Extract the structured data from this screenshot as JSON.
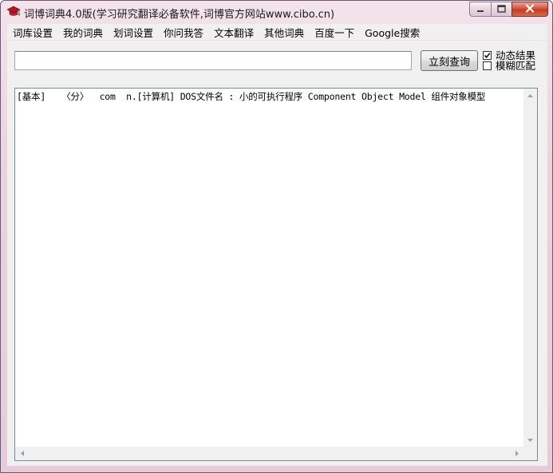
{
  "window": {
    "title": "词博词典4.0版(学习研究翻译必备软件,词博官方网站www.cibo.cn)",
    "icon": "graduation-cap-icon"
  },
  "menu": {
    "items": [
      {
        "label": "词库设置"
      },
      {
        "label": "我的词典"
      },
      {
        "label": "划词设置"
      },
      {
        "label": "你问我答"
      },
      {
        "label": "文本翻译"
      },
      {
        "label": "其他词典"
      },
      {
        "label": "百度一下"
      },
      {
        "label": "Google搜索"
      }
    ]
  },
  "search": {
    "value": "",
    "query_button": "立刻查询"
  },
  "options": {
    "dynamic_results": {
      "label": "动态结果",
      "checked": true
    },
    "fuzzy_match": {
      "label": "模糊匹配",
      "checked": false
    }
  },
  "results": {
    "line1": "[基本]   〈分〉  com  n.[计算机] DOS文件名 : 小的可执行程序 Component Object Model 组件对象模型"
  },
  "colors": {
    "frame": "#e6ccd8",
    "close_button": "#c43c22",
    "client_bg": "#f0f0f0"
  }
}
